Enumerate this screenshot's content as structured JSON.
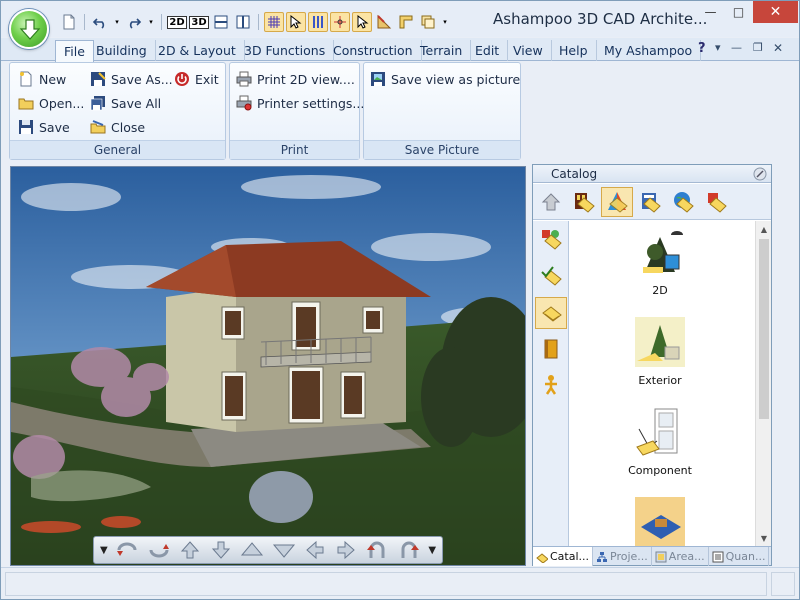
{
  "window": {
    "title": "Ashampoo 3D CAD Archite...",
    "minimize_glyph": "—",
    "maximize_glyph": "□",
    "close_glyph": "✕"
  },
  "quick_access": {
    "items": [
      "new-doc-icon",
      "undo-icon",
      "redo-icon",
      "view-2d-icon",
      "view-3d-icon",
      "split-horizontal-icon",
      "split-vertical-icon",
      "grid-icon",
      "select-icon",
      "columns-icon",
      "snap-icon",
      "pointer-icon",
      "measure-icon",
      "copy-icon"
    ],
    "btn_2d": "2D",
    "btn_3d": "3D"
  },
  "tabs": [
    {
      "label": "File",
      "active": true
    },
    {
      "label": "Building"
    },
    {
      "label": "2D & Layout"
    },
    {
      "label": "3D Functions"
    },
    {
      "label": "Construction"
    },
    {
      "label": "Terrain"
    },
    {
      "label": "Edit"
    },
    {
      "label": "View"
    },
    {
      "label": "Help"
    },
    {
      "label": "My Ashampoo"
    }
  ],
  "ribbon": {
    "general": {
      "label": "General",
      "new": "New",
      "open": "Open...",
      "save": "Save",
      "save_as": "Save As...",
      "save_all": "Save All",
      "close": "Close",
      "exit": "Exit"
    },
    "print": {
      "label": "Print",
      "print_2d": "Print 2D view....",
      "printer_settings": "Printer settings..."
    },
    "save_picture": {
      "label": "Save Picture",
      "save_view": "Save view as picture"
    }
  },
  "catalog": {
    "title": "Catalog",
    "items": [
      {
        "label": "2D"
      },
      {
        "label": "Exterior"
      },
      {
        "label": "Component"
      }
    ],
    "tabs": [
      "Catal...",
      "Proje...",
      "Area...",
      "Quan..."
    ]
  },
  "colors": {
    "accent": "#3d6fb3",
    "active_tab": "#f5f9fd",
    "highlight": "#f9e6b0",
    "close_button": "#c7463b"
  }
}
